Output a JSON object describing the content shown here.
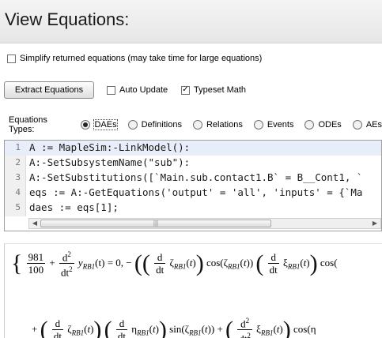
{
  "header": {
    "title": "View Equations:"
  },
  "simplify": {
    "label": "Simplify returned equations (may take time for large equations)",
    "checked": false
  },
  "toolbar": {
    "extract_label": "Extract Equations",
    "auto_update_label": "Auto Update",
    "typeset_label": "Typeset Math",
    "typeset_checked": true
  },
  "types": {
    "label": "Equations Types:",
    "options": [
      {
        "label": "DAEs",
        "selected": true
      },
      {
        "label": "Definitions",
        "selected": false
      },
      {
        "label": "Relations",
        "selected": false
      },
      {
        "label": "Events",
        "selected": false
      },
      {
        "label": "ODEs",
        "selected": false
      },
      {
        "label": "AEs",
        "selected": false
      }
    ]
  },
  "code": {
    "lines": [
      {
        "n": "1",
        "text": "A := MapleSim:-LinkModel():"
      },
      {
        "n": "2",
        "text": "A:-SetSubsystemName(\"sub\"):"
      },
      {
        "n": "3",
        "text": "A:-SetSubstitutions([`Main.sub.contact1.B` = B__Cont1, `"
      },
      {
        "n": "4",
        "text": "eqs := A:-GetEquations('output' = 'all', 'inputs' = {`Ma"
      },
      {
        "n": "5",
        "text": "daes := eqs[1];"
      }
    ]
  },
  "output": {
    "row1": {
      "frac_num": "981",
      "frac_den": "100",
      "plus": "+",
      "d2": "d",
      "dt2": "dt",
      "y": "y",
      "sub": "RB1",
      "t": "(t)",
      "eq": "= 0, −",
      "zeta": "ζ",
      "cos": "cos",
      "xi": "ξ"
    },
    "row2": {
      "eta": "η",
      "sin": "sin",
      "cos": "cos"
    }
  }
}
